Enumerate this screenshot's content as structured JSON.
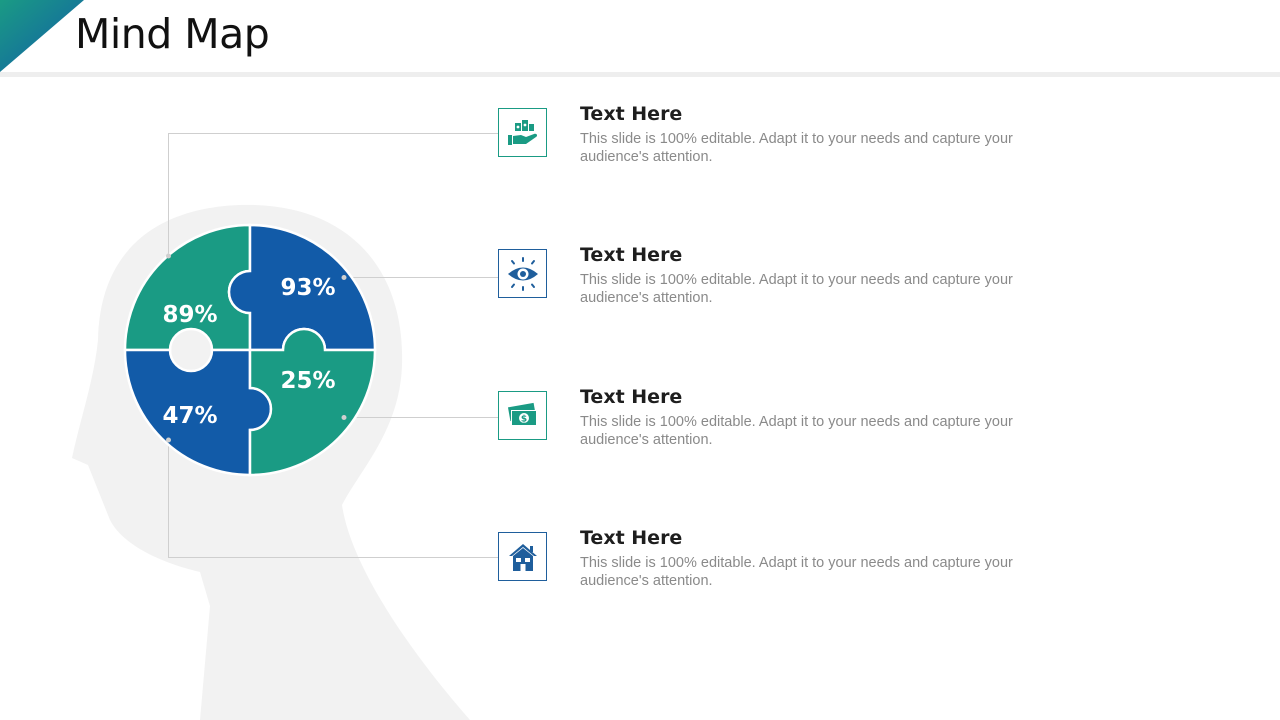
{
  "slide": {
    "title": "Mind Map",
    "colors": {
      "accent_green": "#1a9b84",
      "accent_blue": "#125ba8",
      "head_silhouette": "#f2f2f2",
      "title_rule": "#eeeeee"
    }
  },
  "puzzle": {
    "pieces": [
      {
        "position": "top-left",
        "label": "89%",
        "color": "green"
      },
      {
        "position": "top-right",
        "label": "93%",
        "color": "blue"
      },
      {
        "position": "bottom-left",
        "label": "47%",
        "color": "blue"
      },
      {
        "position": "bottom-right",
        "label": "25%",
        "color": "green"
      }
    ]
  },
  "items": [
    {
      "heading": "Text Here",
      "description": "This slide is 100% editable. Adapt it to your needs and capture your audience's attention.",
      "icon": "money-in-hand-icon"
    },
    {
      "heading": "Text Here",
      "description": "This slide is 100% editable. Adapt it to your needs and capture your audience's attention.",
      "icon": "eye-icon"
    },
    {
      "heading": "Text Here",
      "description": "This slide is 100% editable. Adapt it to your needs and capture your audience's attention.",
      "icon": "cash-bills-icon"
    },
    {
      "heading": "Text Here",
      "description": "This slide is 100% editable. Adapt it to your needs and capture your audience's attention.",
      "icon": "house-icon"
    }
  ]
}
